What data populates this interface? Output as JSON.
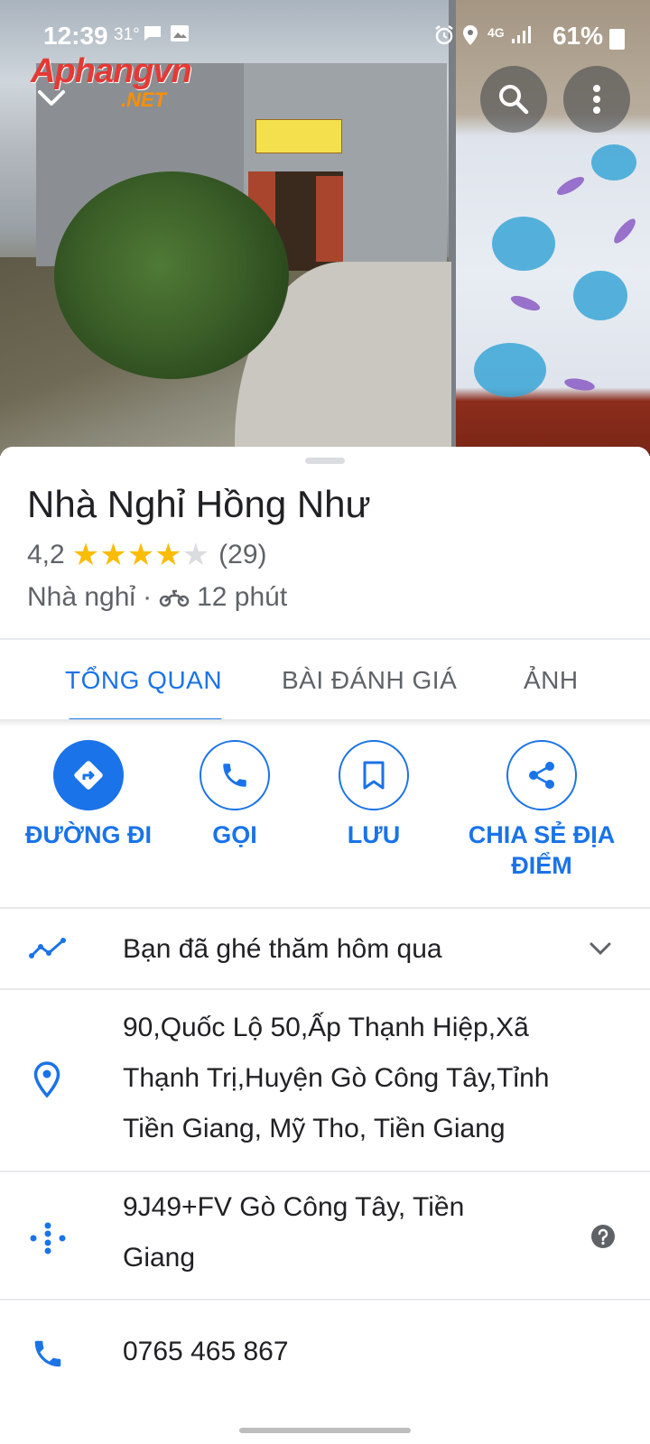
{
  "status_bar": {
    "time": "12:39",
    "temp": "31°",
    "network": "4G",
    "battery": "61%"
  },
  "watermark": {
    "line1": "Aphangvn",
    "line2": ".NET"
  },
  "place": {
    "name": "Nhà Nghỉ Hồng Như",
    "rating": "4,2",
    "stars": 4.2,
    "review_count": "(29)",
    "category": "Nhà nghỉ",
    "separator": "·",
    "travel_time": "12 phút"
  },
  "tabs": [
    {
      "label": "TỔNG QUAN",
      "active": true
    },
    {
      "label": "BÀI ĐÁNH GIÁ",
      "active": false
    },
    {
      "label": "ẢNH",
      "active": false
    }
  ],
  "actions": {
    "directions": "ĐƯỜNG ĐI",
    "call": "GỌI",
    "save": "LƯU",
    "share_line1": "CHIA SẺ ĐỊA",
    "share_line2": "ĐIỂM"
  },
  "info": {
    "visited": "Bạn đã ghé thăm hôm qua",
    "address_l1": "90,Quốc Lộ 50,Ấp Thạnh Hiệp,Xã",
    "address_l2": "Thạnh Trị,Huyện Gò Công Tây,Tỉnh",
    "address_l3": "Tiền Giang, Mỹ Tho, Tiền Giang",
    "pluscode_l1": "9J49+FV Gò Công Tây, Tiền",
    "pluscode_l2": "Giang",
    "phone": "0765 465 867"
  },
  "colors": {
    "accent": "#1a73e8",
    "star": "#fbbc04",
    "text": "#202124",
    "secondary": "#5f6368"
  }
}
